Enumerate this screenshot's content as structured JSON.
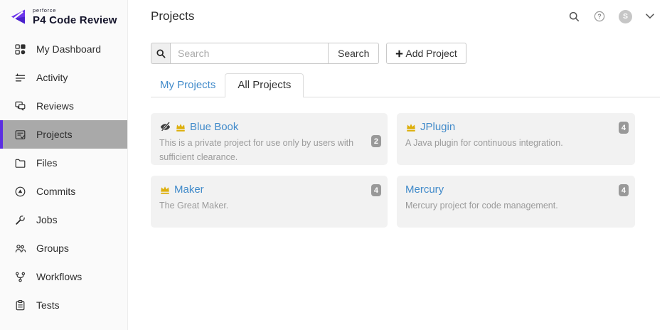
{
  "colors": {
    "accent_purple": "#5b2ee1",
    "link_blue": "#428bca",
    "badge_bg": "#999999",
    "crown_gold": "#ddaf0c",
    "card_bg": "#f2f2f2",
    "selected_item_bg": "#a9a9a9",
    "sidebar_bg": "#fafafa"
  },
  "logo": {
    "brand": "perforce",
    "product": "P4 Code Review",
    "icon": "perforce-logo-icon"
  },
  "sidebar": {
    "items": [
      {
        "label": "My Dashboard",
        "icon": "dashboard-icon",
        "active": false
      },
      {
        "label": "Activity",
        "icon": "activity-icon",
        "active": false
      },
      {
        "label": "Reviews",
        "icon": "reviews-icon",
        "active": false
      },
      {
        "label": "Projects",
        "icon": "projects-icon",
        "active": true
      },
      {
        "label": "Files",
        "icon": "files-icon",
        "active": false
      },
      {
        "label": "Commits",
        "icon": "commits-icon",
        "active": false
      },
      {
        "label": "Jobs",
        "icon": "jobs-icon",
        "active": false
      },
      {
        "label": "Groups",
        "icon": "groups-icon",
        "active": false
      },
      {
        "label": "Workflows",
        "icon": "workflows-icon",
        "active": false
      },
      {
        "label": "Tests",
        "icon": "tests-icon",
        "active": false
      }
    ]
  },
  "topbar": {
    "title": "Projects",
    "icons": [
      "search-icon",
      "help-icon",
      "avatar",
      "chevron-down-icon"
    ],
    "avatar_initial": "S"
  },
  "toolbar": {
    "search_placeholder": "Search",
    "search_value": "",
    "search_button_label": "Search",
    "add_project_label": "Add Project"
  },
  "tabs": [
    {
      "label": "My Projects",
      "active": false
    },
    {
      "label": "All Projects",
      "active": true
    }
  ],
  "projects": [
    {
      "title": "Blue Book",
      "description": "This is a private project for use only by users with suffi­cient clearance.",
      "open_reviews_count": "2",
      "is_private": true,
      "is_owner": true
    },
    {
      "title": "JPlugin",
      "description": "A Java plugin for continuous integration.",
      "open_reviews_count": "4",
      "is_private": false,
      "is_owner": true
    },
    {
      "title": "Maker",
      "description": "The Great Maker.",
      "open_reviews_count": "4",
      "is_private": false,
      "is_owner": true
    },
    {
      "title": "Mercury",
      "description": "Mercury project for code management.",
      "open_reviews_count": "4",
      "is_private": false,
      "is_owner": false
    }
  ]
}
